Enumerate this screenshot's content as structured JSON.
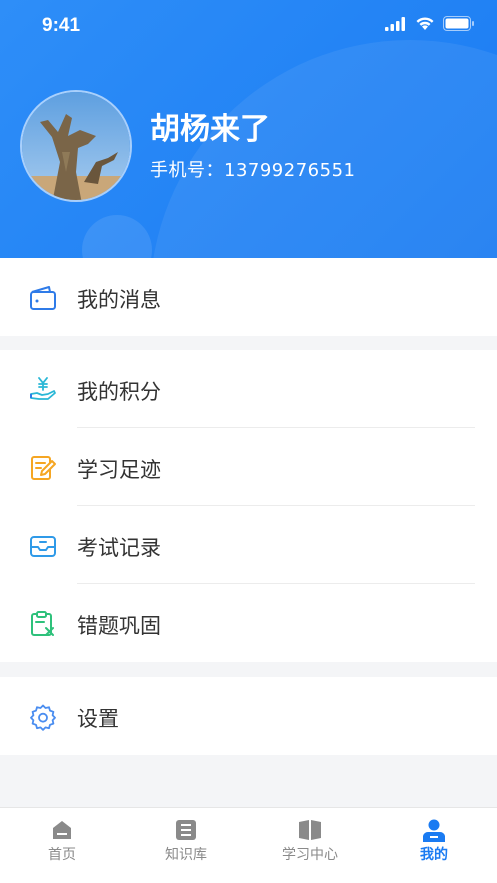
{
  "status_bar": {
    "time": "9:41",
    "icons": [
      "signal-icon",
      "wifi-icon",
      "battery-icon"
    ]
  },
  "profile": {
    "name": "胡杨来了",
    "phone": "手机号：13799276551"
  },
  "menu": {
    "group1": [
      {
        "label": "我的消息",
        "icon": "wallet-icon"
      }
    ],
    "group2": [
      {
        "label": "我的积分",
        "icon": "yen-hand-icon"
      },
      {
        "label": "学习足迹",
        "icon": "notebook-pen-icon"
      },
      {
        "label": "考试记录",
        "icon": "tray-icon"
      },
      {
        "label": "错题巩固",
        "icon": "clipboard-x-icon"
      }
    ],
    "group3": [
      {
        "label": "设置",
        "icon": "gear-icon"
      }
    ]
  },
  "tabbar": {
    "tabs": [
      {
        "label": "首页",
        "icon": "home-icon",
        "active": false
      },
      {
        "label": "知识库",
        "icon": "document-icon",
        "active": false
      },
      {
        "label": "学习中心",
        "icon": "book-icon",
        "active": false
      },
      {
        "label": "我的",
        "icon": "user-icon",
        "active": true
      }
    ]
  },
  "colors": {
    "primary": "#1a7bf2",
    "header_bg": "#2e8ef8",
    "text": "#333333",
    "tab_inactive": "#8a8a8a"
  }
}
